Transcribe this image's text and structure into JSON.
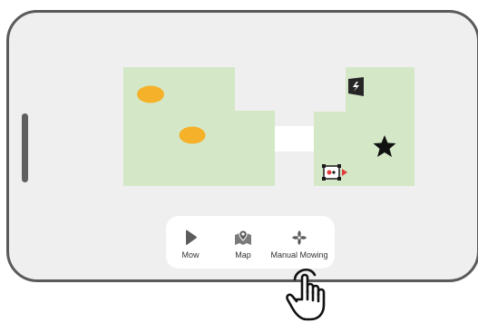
{
  "bottom_nav": {
    "items": [
      {
        "label": "Mow",
        "icon": "play-icon"
      },
      {
        "label": "Map",
        "icon": "map-pin-icon"
      },
      {
        "label": "Manual Mowing",
        "icon": "fan-icon"
      }
    ]
  },
  "map": {
    "lawn_color": "#d4e8c8",
    "obstacle_color": "#f5b12a",
    "icons": [
      "charging-station-icon",
      "star-icon",
      "mower-icon"
    ]
  },
  "colors": {
    "frame": "#5a5a5a",
    "screen_background": "#efefef",
    "nav_background": "#ffffff",
    "icon_gray": "#5c5c5c",
    "mower_direction": "#e03b3b"
  }
}
